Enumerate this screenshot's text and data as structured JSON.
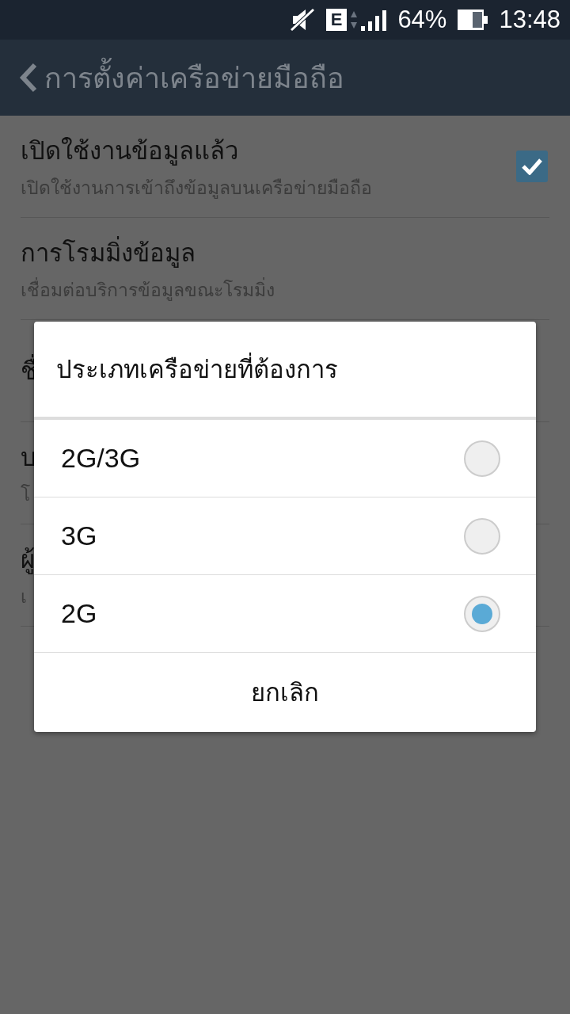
{
  "status_bar": {
    "network_type": "E",
    "battery": "64%",
    "time": "13:48"
  },
  "app_bar": {
    "title": "การตั้งค่าเครือข่ายมือถือ"
  },
  "settings": [
    {
      "title": "เปิดใช้งานข้อมูลแล้ว",
      "summary": "เปิดใช้งานการเข้าถึงข้อมูลบนเครือข่ายมือถือ",
      "kind": "checkbox",
      "checked": true
    },
    {
      "title": "การโรมมิ่งข้อมูล",
      "summary": "เชื่อมต่อบริการข้อมูลขณะโรมมิ่ง",
      "kind": "plain"
    },
    {
      "title": "ชื่",
      "kind": "plain"
    },
    {
      "title": "บ",
      "summary": "โ",
      "kind": "plain"
    },
    {
      "title": "ผู้",
      "summary": "เ",
      "kind": "plain"
    }
  ],
  "dialog": {
    "title": "ประเภทเครือข่ายที่ต้องการ",
    "options": [
      {
        "label": "2G/3G",
        "selected": false
      },
      {
        "label": "3G",
        "selected": false
      },
      {
        "label": "2G",
        "selected": true
      }
    ],
    "cancel": "ยกเลิก"
  }
}
